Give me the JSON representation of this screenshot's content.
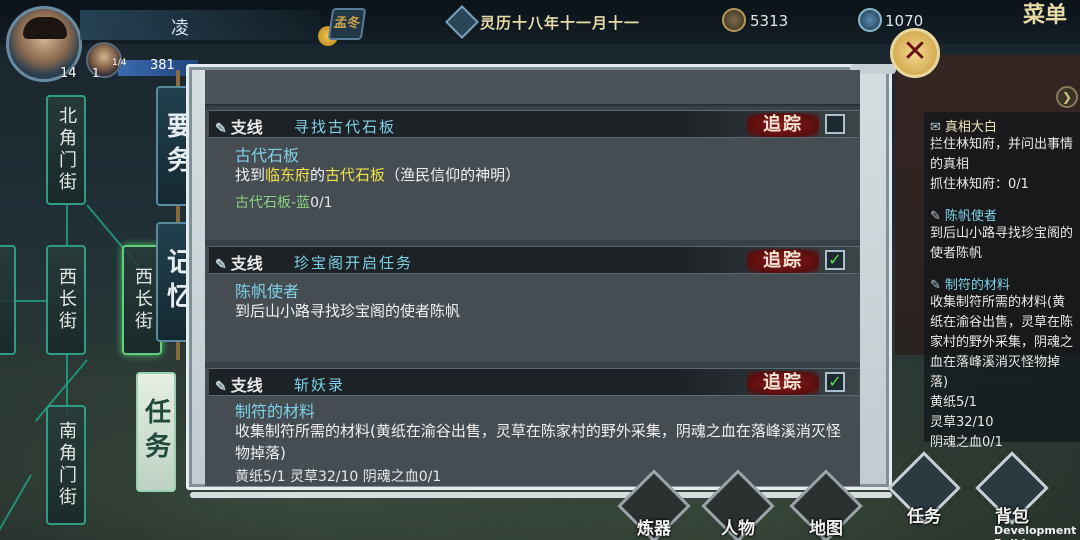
{
  "header": {
    "player_name": "凌",
    "player_level": "14",
    "companion_tag": "1/4",
    "companion_level": "1",
    "companion_hp": "381",
    "season_label": "孟冬",
    "date": "灵历十八年十一月十一",
    "currency_coin": "5313",
    "currency_jade": "1070",
    "menu_label": "菜单"
  },
  "map_nodes": [
    {
      "label": "北角门街"
    },
    {
      "label": "西长街"
    },
    {
      "label": "西长街"
    },
    {
      "label": "南角门街"
    }
  ],
  "side_tabs": [
    {
      "label": "要务"
    },
    {
      "label": "记忆"
    },
    {
      "label": "任务"
    }
  ],
  "quests": [
    {
      "type": "支线",
      "title": "寻找古代石板",
      "track_label": "追踪",
      "tracked": false,
      "subtitle": "古代石板",
      "desc_prefix": "找到",
      "desc_place": "临东府",
      "desc_mid": "的",
      "desc_item": "古代石板",
      "desc_suffix": "（渔民信仰的神明）",
      "progress_label": "古代石板-蓝",
      "progress_count": "0/1"
    },
    {
      "type": "支线",
      "title": "珍宝阁开启任务",
      "track_label": "追踪",
      "tracked": true,
      "subtitle": "陈帆使者",
      "desc": "到后山小路寻找珍宝阁的使者陈帆"
    },
    {
      "type": "支线",
      "title": "斩妖录",
      "track_label": "追踪",
      "tracked": true,
      "subtitle": "制符的材料",
      "desc": "收集制符所需的材料(黄纸在渝谷出售，灵草在陈家村的野外采集，阴魂之血在落峰溪消灭怪物掉落)",
      "progress_partial": "黄纸5/1    灵草32/10    阴魂之血0/1"
    }
  ],
  "tracked_list": [
    {
      "title": "真相大白",
      "desc": "拦住林知府，并问出事情的真相",
      "progress": "抓住林知府：0/1"
    },
    {
      "title": "陈帆使者",
      "desc": "到后山小路寻找珍宝阁的使者陈帆",
      "progress": ""
    },
    {
      "title": "制符的材料",
      "desc": "收集制符所需的材料(黄纸在渝谷出售，灵草在陈家村的野外采集，阴魂之血在落峰溪消灭怪物掉落)",
      "progress": "黄纸5/1\n灵草32/10\n阴魂之血0/1"
    }
  ],
  "bottom_bar": [
    {
      "label": "炼器"
    },
    {
      "label": "人物"
    },
    {
      "label": "地图"
    },
    {
      "label": "任务"
    },
    {
      "label": "背包"
    }
  ],
  "dev_build": "Development Build",
  "icons": {
    "close": "close-icon",
    "check": "check-icon",
    "pen": "brush-icon",
    "coin": "coin-icon",
    "jade": "jade-icon"
  },
  "colors": {
    "quest_title": "#7fd0e6",
    "highlight": "#f2e24a",
    "progress": "#8ad080",
    "track_badge": "#8a1a1a",
    "check": "#5ce04a"
  }
}
